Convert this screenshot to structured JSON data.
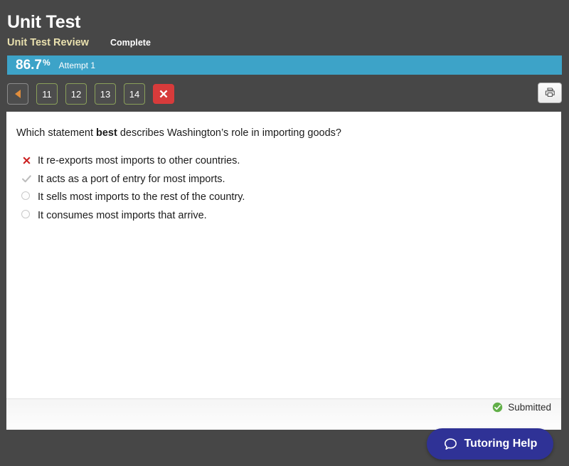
{
  "header": {
    "unit_title": "Unit Test",
    "review_title": "Unit Test Review",
    "status": "Complete"
  },
  "score": {
    "value": "86.7",
    "percent_symbol": "%",
    "attempt": "Attempt 1",
    "bar_color": "#3da3c8"
  },
  "toolbar": {
    "back_label": "",
    "question_buttons": [
      {
        "label": "11"
      },
      {
        "label": "12"
      },
      {
        "label": "13"
      },
      {
        "label": "14"
      }
    ],
    "incorrect_marker_label": "",
    "print_label": ""
  },
  "question": {
    "text_before": "Which statement ",
    "emphasis": "best",
    "text_after": " describes Washington’s role in importing goods?",
    "options": [
      {
        "marker": "incorrect-x-icon",
        "text": "It re-exports most imports to other countries."
      },
      {
        "marker": "correct-check-icon",
        "text": "It acts as a port of entry for most imports."
      },
      {
        "marker": "radio-empty-icon",
        "text": "It sells most imports to the rest of the country."
      },
      {
        "marker": "radio-empty-icon",
        "text": "It consumes most imports that arrive."
      }
    ]
  },
  "footer": {
    "submitted_label": "Submitted",
    "submitted_color": "#62af49"
  },
  "tutoring": {
    "label": "Tutoring Help",
    "color": "#2f3296"
  }
}
